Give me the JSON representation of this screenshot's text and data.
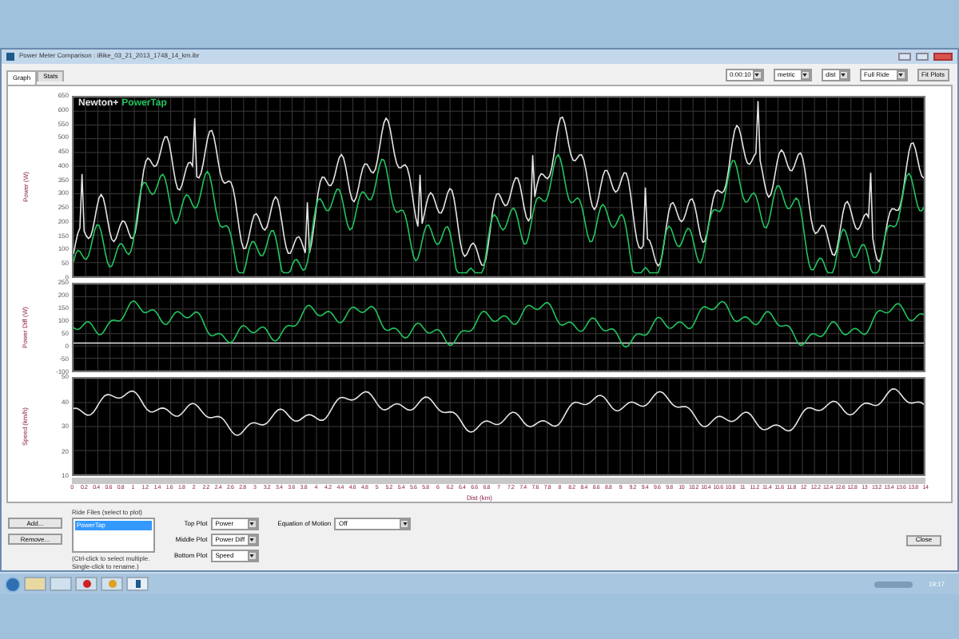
{
  "window": {
    "title": "Power Meter Comparison : iBike_03_21_2013_1748_14_km.ibr"
  },
  "tabs": [
    {
      "label": "Graph",
      "selected": true
    },
    {
      "label": "Stats",
      "selected": false
    }
  ],
  "toolbar": {
    "dropdowns": [
      "0:00:10",
      "metric",
      "dist",
      "Full Ride"
    ],
    "button": "Fit Plots"
  },
  "plots": [
    {
      "ylabel": "Power (W)",
      "yticks": [
        "650",
        "600",
        "550",
        "500",
        "450",
        "400",
        "350",
        "300",
        "250",
        "200",
        "150",
        "100",
        "50",
        "0"
      ],
      "legend": [
        {
          "label": "Newton+",
          "color": "#e5e5e5"
        },
        {
          "label": "PowerTap",
          "color": "#22c55e"
        }
      ]
    },
    {
      "ylabel": "Power Diff (W)",
      "yticks": [
        "250",
        "200",
        "150",
        "100",
        "50",
        "0",
        "-50",
        "-100"
      ]
    },
    {
      "ylabel": "Speed (km/h)",
      "yticks": [
        "50",
        "40",
        "30",
        "20",
        "10"
      ]
    }
  ],
  "xaxis": {
    "label": "Dist (km)",
    "ticks": [
      "0",
      "0.2",
      "0.4",
      "0.6",
      "0.8",
      "1",
      "1.2",
      "1.4",
      "1.6",
      "1.8",
      "2",
      "2.2",
      "2.4",
      "2.6",
      "2.8",
      "3",
      "3.2",
      "3.4",
      "3.6",
      "3.8",
      "4",
      "4.2",
      "4.4",
      "4.6",
      "4.8",
      "5",
      "5.2",
      "5.4",
      "5.6",
      "5.8",
      "6",
      "6.2",
      "6.4",
      "6.6",
      "6.8",
      "7",
      "7.2",
      "7.4",
      "7.6",
      "7.8",
      "8",
      "8.2",
      "8.4",
      "8.6",
      "8.8",
      "9",
      "9.2",
      "9.4",
      "9.6",
      "9.8",
      "10",
      "10.2",
      "10.4",
      "10.6",
      "10.8",
      "11",
      "11.2",
      "11.4",
      "11.6",
      "11.8",
      "12",
      "12.2",
      "12.4",
      "12.6",
      "12.8",
      "13",
      "13.2",
      "13.4",
      "13.6",
      "13.8",
      "14"
    ]
  },
  "file_buttons": [
    "Add...",
    "Remove..."
  ],
  "ride_files": {
    "label": "Ride Files (select to plot)",
    "items": [
      {
        "label": "PowerTap",
        "selected": true
      }
    ],
    "hint": "(Ctrl-click to select multiple. Single-click to rename.)"
  },
  "plot_selects": [
    {
      "label": "Top Plot",
      "value": "Power"
    },
    {
      "label": "Middle Plot",
      "value": "Power Diff"
    },
    {
      "label": "Bottom Plot",
      "value": "Speed"
    }
  ],
  "equation_of_motion": {
    "label": "Equation of Motion",
    "value": "Off"
  },
  "close_button": "Close",
  "taskbar": {
    "clock": "19:17"
  }
}
